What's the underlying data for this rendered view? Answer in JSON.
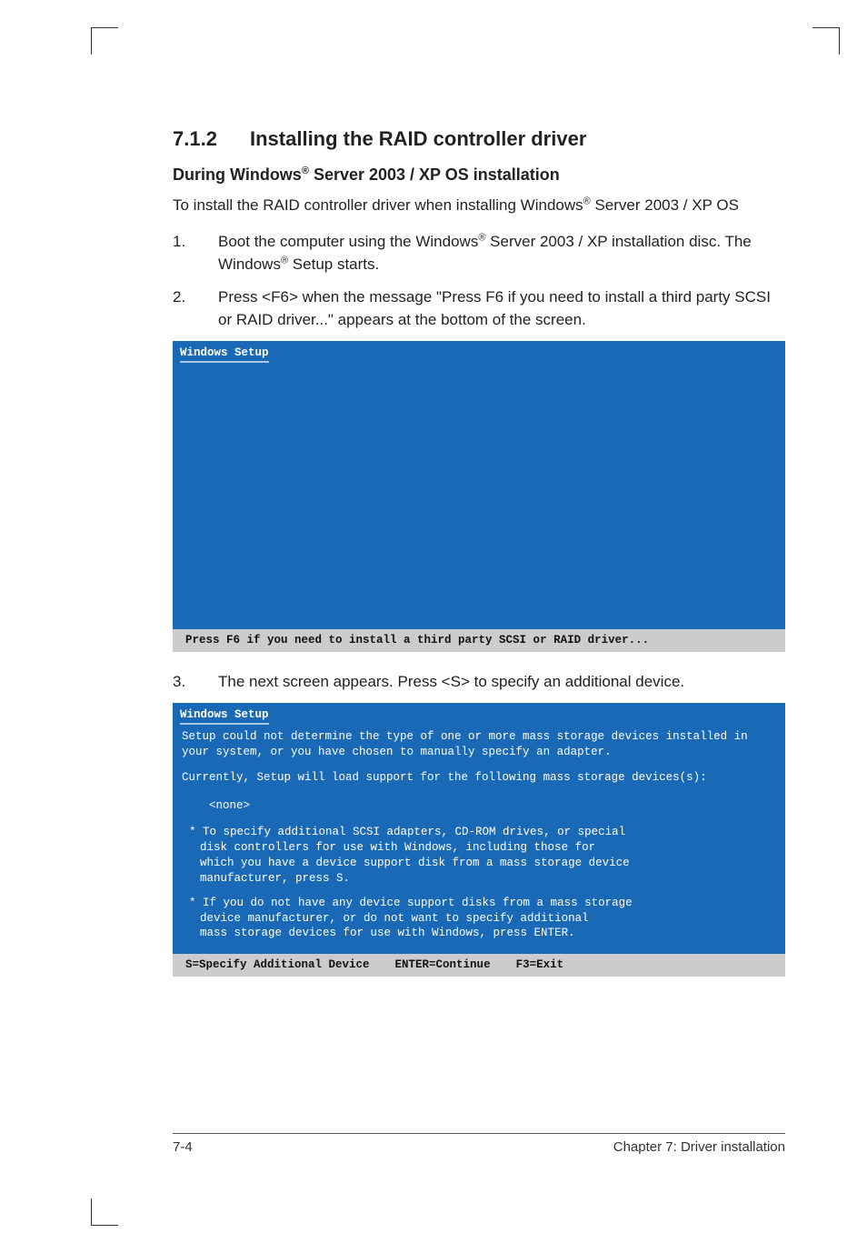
{
  "section": {
    "number": "7.1.2",
    "title": "Installing the RAID controller driver"
  },
  "subsection": {
    "prefix": "During Windows",
    "reg": "®",
    "suffix": " Server 2003 / XP OS installation"
  },
  "intro": {
    "part1": "To install the RAID controller driver when installing Windows",
    "reg": "®",
    "part2": " Server 2003 / XP OS"
  },
  "steps": [
    {
      "n": "1.",
      "parts": [
        "Boot the computer using the Windows",
        "®",
        " Server 2003 / XP installation disc. The Windows",
        "®",
        " Setup starts."
      ]
    },
    {
      "n": "2.",
      "parts": [
        "Press <F6> when the message \"Press F6 if you need to install a third party SCSI or RAID driver...\" appears at the bottom of the screen."
      ]
    }
  ],
  "step3": {
    "n": "3.",
    "text": "The next screen appears. Press <S> to specify an additional device."
  },
  "box1": {
    "title": "Windows Setup",
    "statusbar": "Press F6 if you need to install a third party SCSI or RAID driver..."
  },
  "box2": {
    "title": "Windows Setup",
    "p1": "Setup could not determine the type of one or more mass storage devices installed in your system, or you have chosen to manually specify an adapter.",
    "p2": "Currently, Setup will load support for the following mass storage devices(s):",
    "none": "<none>",
    "b1l1": "* To specify additional SCSI adapters, CD-ROM drives, or special",
    "b1l2": "disk controllers for use with Windows, including those for",
    "b1l3": "which you have a device support disk from a mass storage device",
    "b1l4": "manufacturer, press S.",
    "b2l1": "* If you do not have any device support disks from a mass storage",
    "b2l2": "device manufacturer, or do not want to specify additional",
    "b2l3": "mass storage devices for use with Windows, press ENTER.",
    "status": {
      "s": "S=Specify Additional Device",
      "enter": "ENTER=Continue",
      "f3": "F3=Exit"
    }
  },
  "footer": {
    "left": "7-4",
    "right": "Chapter 7: Driver installation"
  }
}
